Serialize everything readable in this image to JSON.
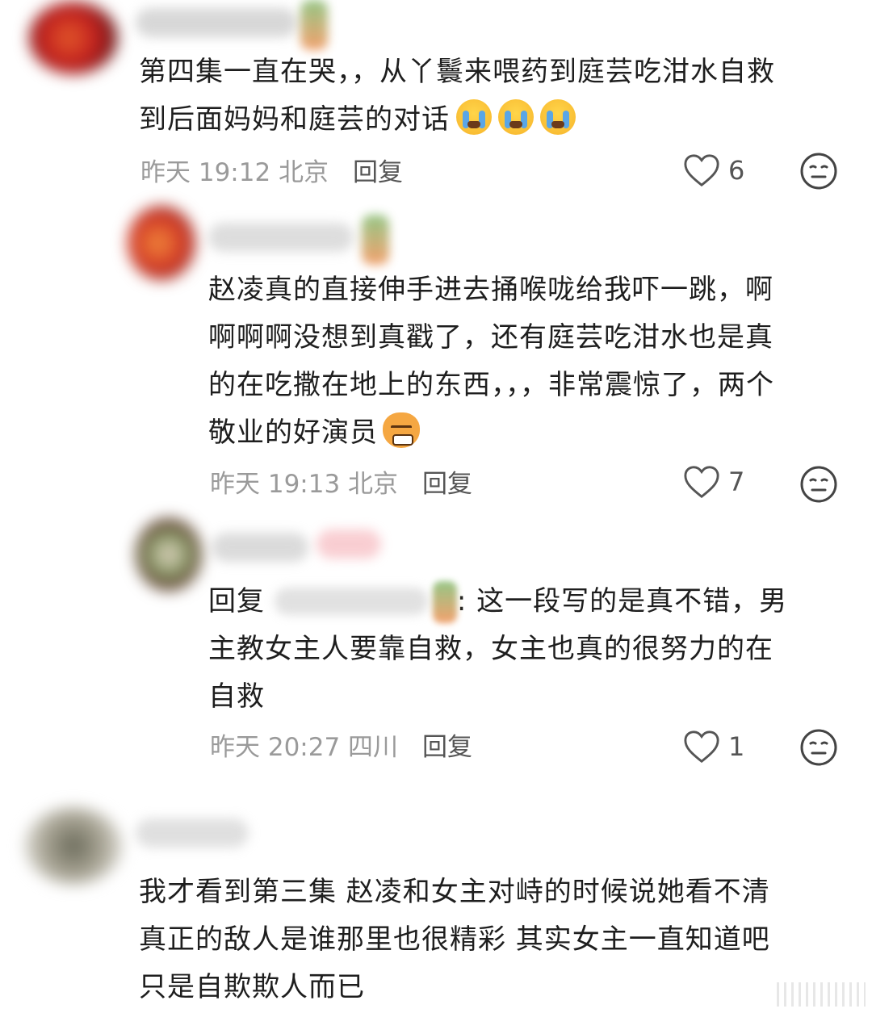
{
  "comments": [
    {
      "text_lines": [
        "第四集一直在哭，，从丫鬟来喂药到庭芸吃泔水自救",
        "到后面妈妈和庭芸的对话"
      ],
      "emoji": [
        "loudly-crying-face",
        "loudly-crying-face",
        "loudly-crying-face"
      ],
      "time": "昨天 19:12 北京",
      "reply_label": "回复",
      "likes": "6"
    },
    {
      "text_lines": [
        "赵凌真的直接伸手进去捅喉咙给我吓一跳，啊",
        "啊啊啊没想到真戳了，还有庭芸吃泔水也是真",
        "的在吃撒在地上的东西，，，非常震惊了，两个",
        "敬业的好演员"
      ],
      "emoji": [
        "cat-face-emoji"
      ],
      "time": "昨天 19:13 北京",
      "reply_label": "回复",
      "likes": "7"
    },
    {
      "reply_prefix": "回复",
      "text_lines": [
        ": 这一段写的是真不错，男",
        "主教女主人要靠自救，女主也真的很努力的在",
        "自救"
      ],
      "time": "昨天 20:27 四川",
      "reply_label": "回复",
      "likes": "1"
    },
    {
      "text_lines": [
        "我才看到第三集 赵凌和女主对峙的时候说她看不清",
        "真正的敌人是谁那里也很精彩 其实女主一直知道吧",
        "只是自欺欺人而已"
      ]
    }
  ],
  "icons": {
    "like": "heart-outline-icon",
    "dislike": "neutral-face-icon"
  }
}
